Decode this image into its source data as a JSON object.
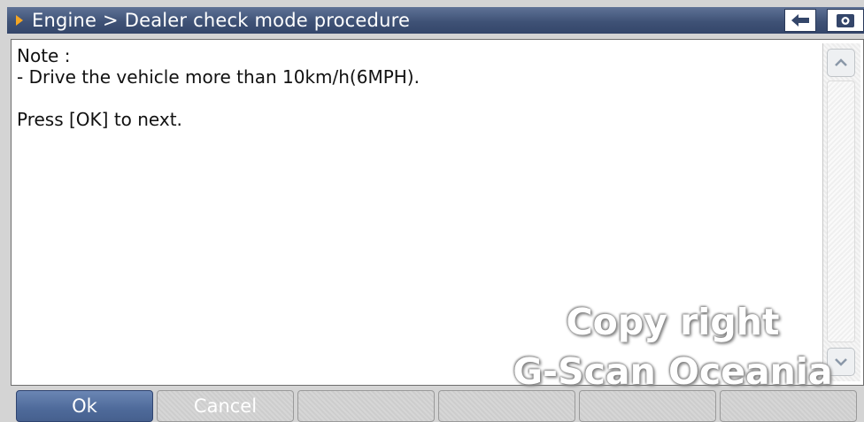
{
  "title_bar": {
    "breadcrumb": "Engine > Dealer check mode procedure",
    "back_icon": "arrow-left-icon",
    "options_icon": "settings-icon"
  },
  "content": {
    "lines": [
      "Note :",
      "- Drive the vehicle more than 10km/h(6MPH).",
      "",
      "Press [OK] to next."
    ]
  },
  "watermark": {
    "line1": "Copy right",
    "line2": "G-Scan Oceania"
  },
  "buttons": [
    {
      "label": "Ok",
      "active": true
    },
    {
      "label": "Cancel",
      "active": false
    },
    {
      "label": "",
      "active": false
    },
    {
      "label": "",
      "active": false
    },
    {
      "label": "",
      "active": false
    },
    {
      "label": "",
      "active": false
    }
  ],
  "colors": {
    "title_bar": "#3f5276",
    "title_arrow": "#f5a623",
    "active_button": "#4e6a9a"
  }
}
